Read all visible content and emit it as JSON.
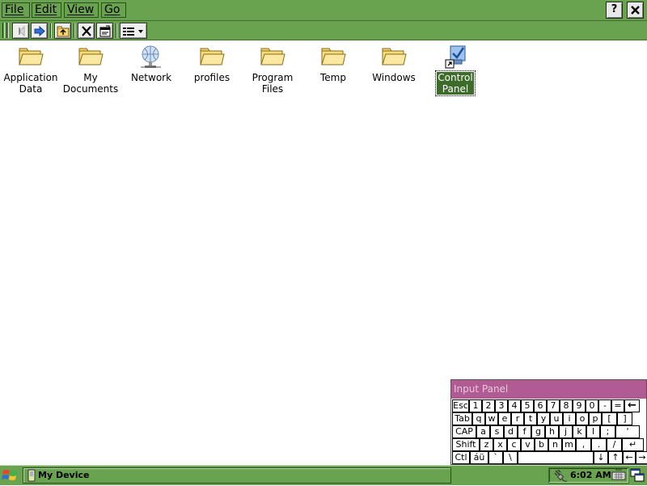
{
  "menu": {
    "items": [
      "File",
      "Edit",
      "View",
      "Go"
    ],
    "help_label": "?",
    "close_label": "X"
  },
  "toolbar": {
    "buttons": [
      "back",
      "forward",
      "up-folder",
      "delete",
      "properties",
      "view-menu"
    ]
  },
  "files": [
    {
      "label": "Application\nData",
      "icon": "folder-icon",
      "selected": false
    },
    {
      "label": "My\nDocuments",
      "icon": "folder-icon",
      "selected": false
    },
    {
      "label": "Network",
      "icon": "network-icon",
      "selected": false
    },
    {
      "label": "profiles",
      "icon": "folder-icon",
      "selected": false
    },
    {
      "label": "Program Files",
      "icon": "folder-icon",
      "selected": false
    },
    {
      "label": "Temp",
      "icon": "folder-icon",
      "selected": false
    },
    {
      "label": "Windows",
      "icon": "folder-icon",
      "selected": false
    },
    {
      "label": "Control\nPanel",
      "icon": "control-panel-shortcut-icon",
      "selected": true
    }
  ],
  "input_panel": {
    "title": "Input Panel",
    "rows": [
      [
        "Esc",
        "1",
        "2",
        "3",
        "4",
        "5",
        "6",
        "7",
        "8",
        "9",
        "0",
        "-",
        "=",
        "←"
      ],
      [
        "Tab",
        "q",
        "w",
        "e",
        "r",
        "t",
        "y",
        "u",
        "i",
        "o",
        "p",
        "[",
        "]"
      ],
      [
        "CAP",
        "a",
        "s",
        "d",
        "f",
        "g",
        "h",
        "j",
        "k",
        "l",
        ";",
        "'"
      ],
      [
        "Shift",
        "z",
        "x",
        "c",
        "v",
        "b",
        "n",
        "m",
        ",",
        ".",
        "/",
        "↵"
      ],
      [
        "Ctl",
        "áü",
        "`",
        "\\",
        "",
        "↓",
        "↑",
        "←",
        "→"
      ]
    ]
  },
  "taskbar": {
    "task_label": "My Device",
    "clock": "6:02 AM"
  },
  "colors": {
    "chrome_green": "#6aa350",
    "selection_green": "#3d6b2a",
    "input_panel_title": "#b05b93",
    "folder_yellow": "#f5d56a"
  }
}
